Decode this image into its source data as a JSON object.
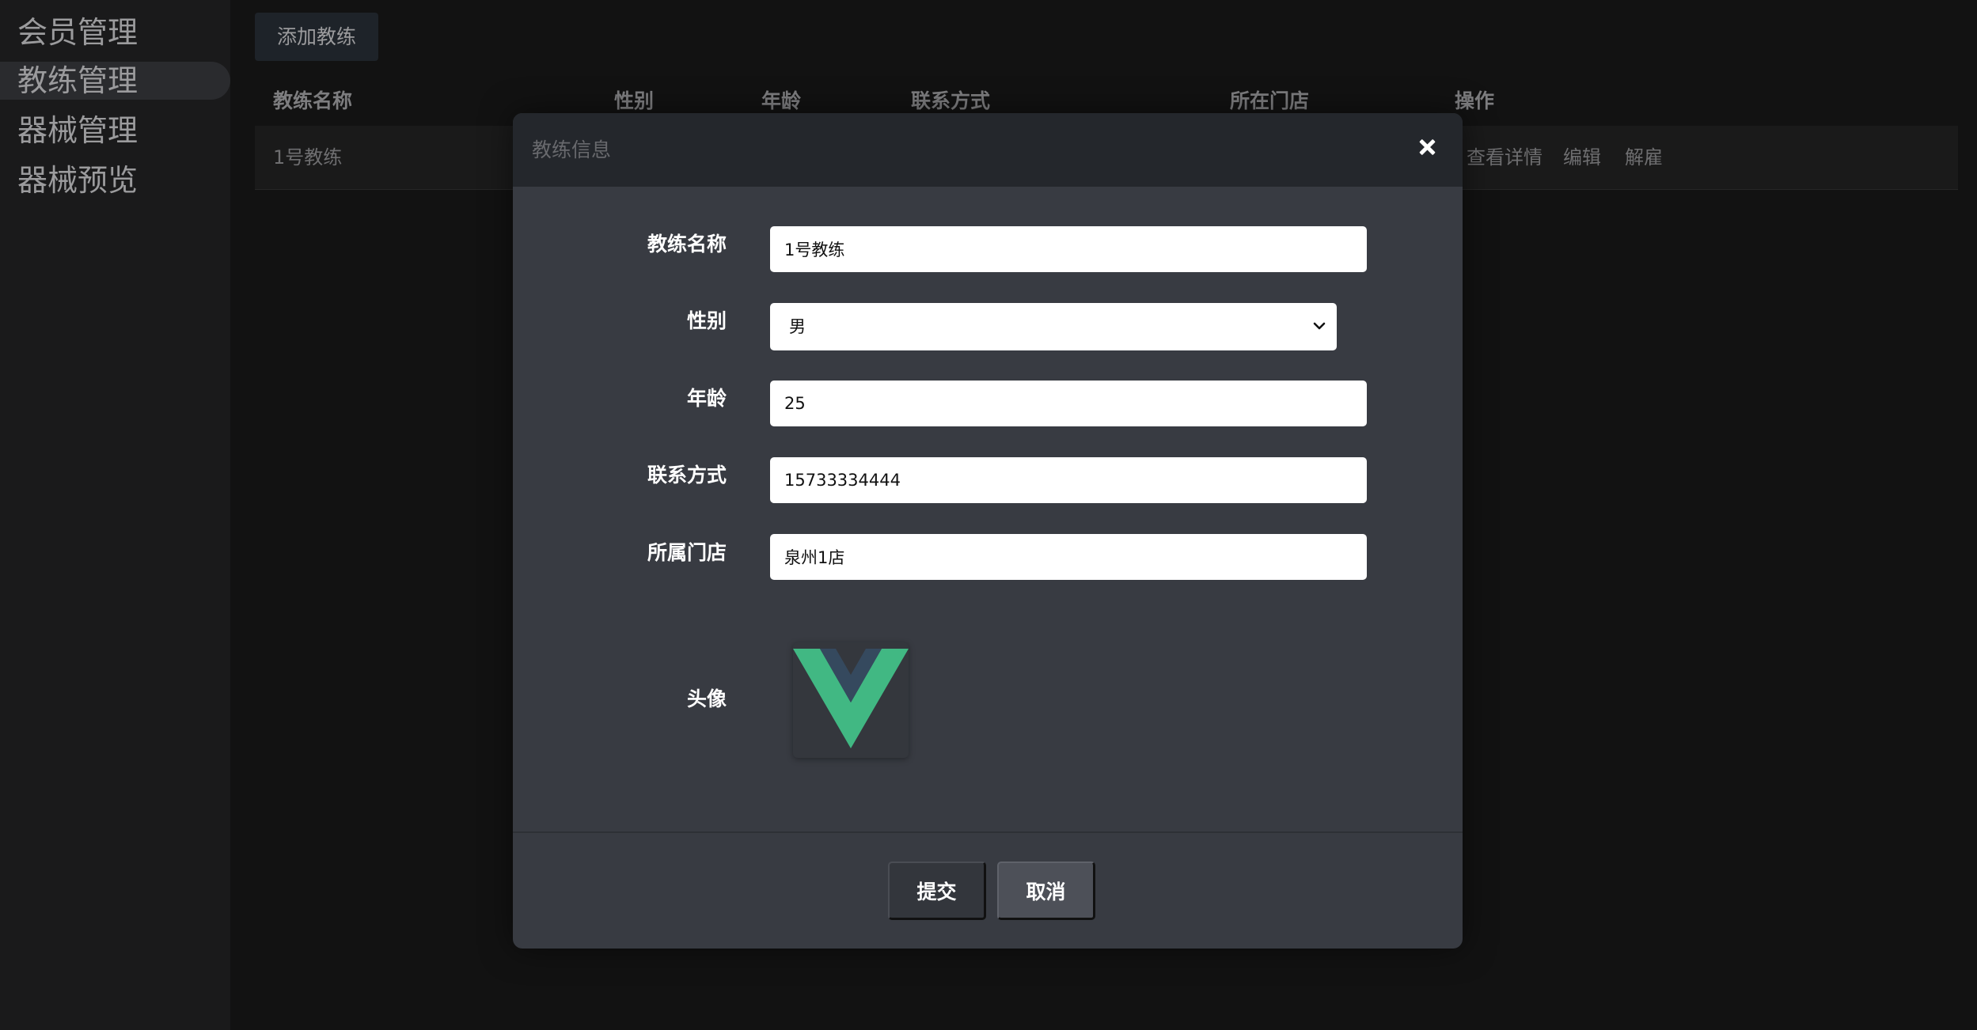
{
  "sidebar": {
    "items": [
      {
        "label": "会员管理"
      },
      {
        "label": "教练管理"
      },
      {
        "label": "器械管理"
      },
      {
        "label": "器械预览"
      }
    ],
    "active_index": 1
  },
  "toolbar": {
    "add_label": "添加教练"
  },
  "table": {
    "headers": [
      "教练名称",
      "性别",
      "年龄",
      "联系方式",
      "所在门店",
      "操作"
    ],
    "rows": [
      {
        "name": "1号教练",
        "actions": [
          "查看详情",
          "编辑",
          "解雇"
        ]
      }
    ]
  },
  "modal": {
    "title": "教练信息",
    "fields": {
      "name": {
        "label": "教练名称",
        "value": "1号教练"
      },
      "gender": {
        "label": "性别",
        "value": "男"
      },
      "age": {
        "label": "年龄",
        "value": "25"
      },
      "phone": {
        "label": "联系方式",
        "value": "15733334444"
      },
      "store": {
        "label": "所属门店",
        "value": "泉州1店"
      },
      "avatar": {
        "label": "头像",
        "icon": "vue-logo-icon"
      }
    },
    "submit_label": "提交",
    "cancel_label": "取消"
  },
  "colors": {
    "background": "#121212",
    "sidebar": "#1a1a1b",
    "modal": "#383b42",
    "modal_header": "#24272c",
    "logo_green": "#41b883",
    "logo_dark": "#35495e"
  }
}
